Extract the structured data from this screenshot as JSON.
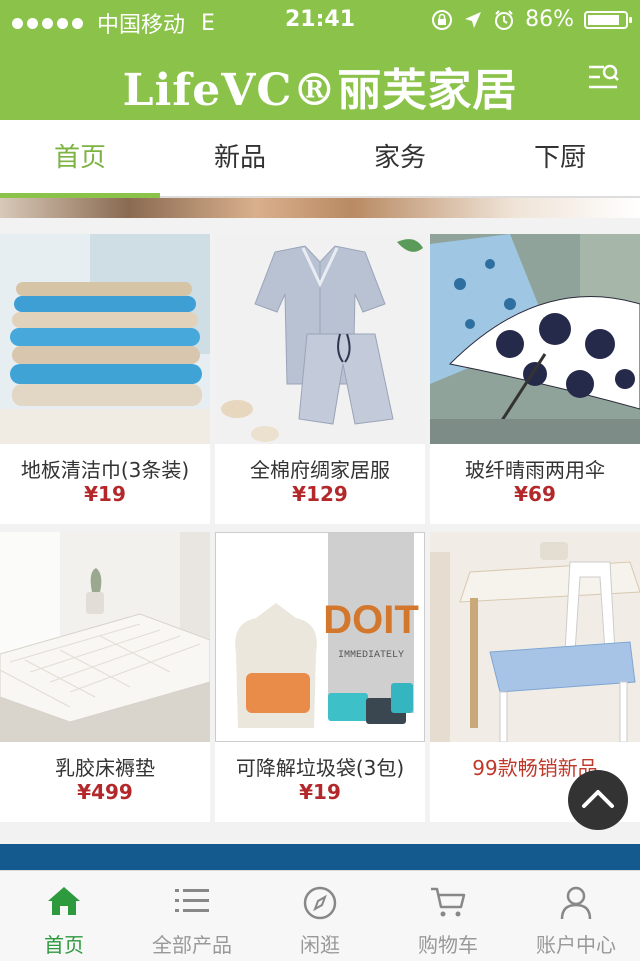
{
  "status": {
    "carrier": "中国移动",
    "network": "E",
    "time": "21:41",
    "battery": "86%",
    "battery_fill": 0.86
  },
  "header": {
    "logo": "LifeVC®丽芙家居"
  },
  "tabs": [
    {
      "label": "首页",
      "active": true
    },
    {
      "label": "新品"
    },
    {
      "label": "家务"
    },
    {
      "label": "下厨"
    }
  ],
  "products": [
    {
      "name": "地板清洁巾(3条装)",
      "price": "¥19"
    },
    {
      "name": "全棉府绸家居服",
      "price": "¥129"
    },
    {
      "name": "玻纤晴雨两用伞",
      "price": "¥69"
    },
    {
      "name": "乳胶床褥垫",
      "price": "¥499"
    },
    {
      "name": "可降解垃圾袋(3包)",
      "price": "¥19"
    },
    {
      "name": "99款畅销新品",
      "price": ""
    }
  ],
  "bag_text": {
    "brand": "DOIT",
    "sub": "IMMEDIATELY"
  },
  "bottom_nav": [
    {
      "label": "首页",
      "icon": "home-icon",
      "active": true
    },
    {
      "label": "全部产品",
      "icon": "list-icon"
    },
    {
      "label": "闲逛",
      "icon": "compass-icon"
    },
    {
      "label": "购物车",
      "icon": "cart-icon"
    },
    {
      "label": "账户中心",
      "icon": "user-icon"
    }
  ]
}
